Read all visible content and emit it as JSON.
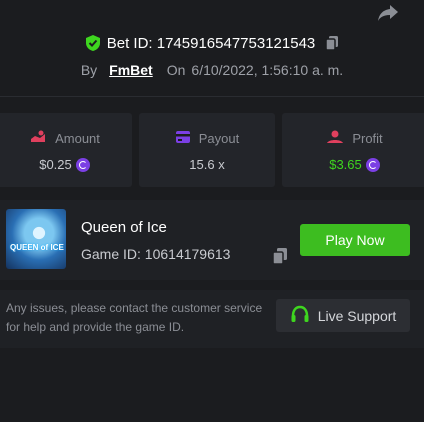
{
  "header": {
    "bet_id": "Bet ID: 1745916547753121543",
    "by_label": "By",
    "username": "FmBet",
    "on_label": "On",
    "datetime": "6/10/2022, 1:56:10 a. m."
  },
  "stats": {
    "amount": {
      "label": "Amount",
      "value": "$0.25"
    },
    "payout": {
      "label": "Payout",
      "value": "15.6 x"
    },
    "profit": {
      "label": "Profit",
      "value": "$3.65"
    }
  },
  "game": {
    "thumbnail_text": "QUEEN of ICE",
    "name": "Queen of Ice",
    "game_id": "Game ID: 10614179613",
    "play_label": "Play Now"
  },
  "support": {
    "message": "Any issues, please contact the customer service for help and provide the game ID.",
    "button_label": "Live Support"
  },
  "colors": {
    "green": "#3ed61f",
    "play_button": "#3dbd20",
    "amount_icon": "#e0405e",
    "payout_icon": "#7b3fe4",
    "profit_icon": "#e0405e",
    "coin": "#7b3fe4"
  },
  "icons": [
    "share-icon",
    "shield-check-icon",
    "copy-icon",
    "amount-icon",
    "payout-icon",
    "profit-icon",
    "coin-icon",
    "headset-icon"
  ]
}
